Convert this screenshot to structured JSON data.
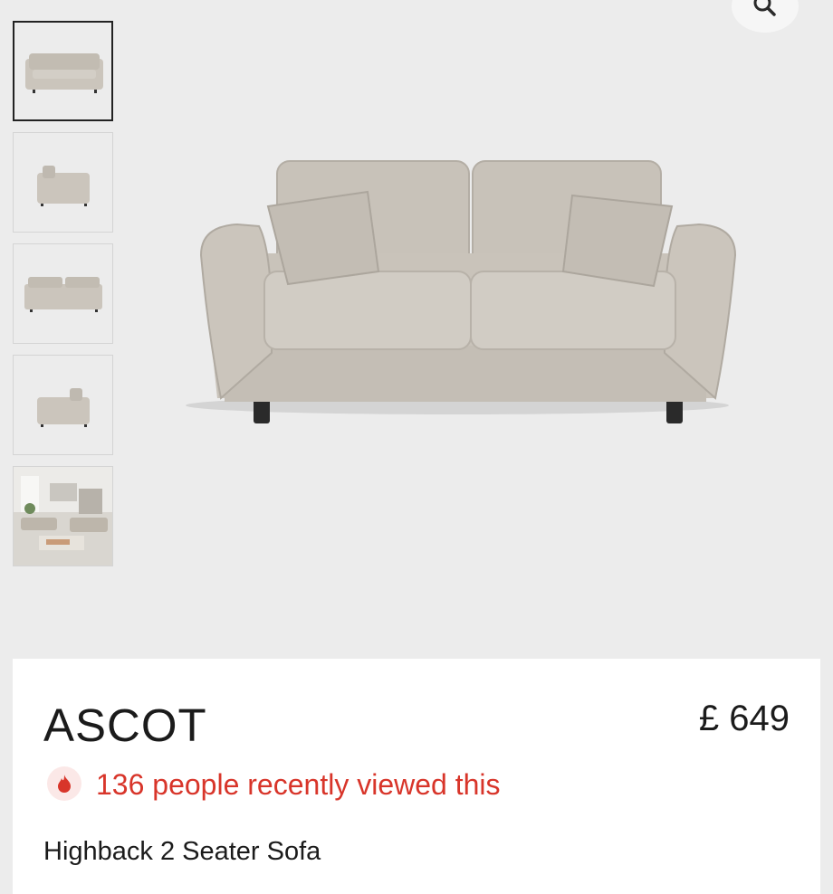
{
  "product": {
    "name": "ASCOT",
    "price": "£ 649",
    "popularity": "136 people recently viewed this",
    "description": "Highback 2 Seater Sofa"
  },
  "gallery": {
    "zoom_icon": "magnifier-icon",
    "thumbnails": [
      {
        "view": "front",
        "selected": true
      },
      {
        "view": "side",
        "selected": false
      },
      {
        "view": "back",
        "selected": false
      },
      {
        "view": "angled-side",
        "selected": false
      },
      {
        "view": "room-scene",
        "selected": false
      }
    ]
  },
  "colors": {
    "fabric": "#c9c3ba",
    "accent_red": "#d8352a",
    "badge_bg": "#fbe8e7"
  }
}
